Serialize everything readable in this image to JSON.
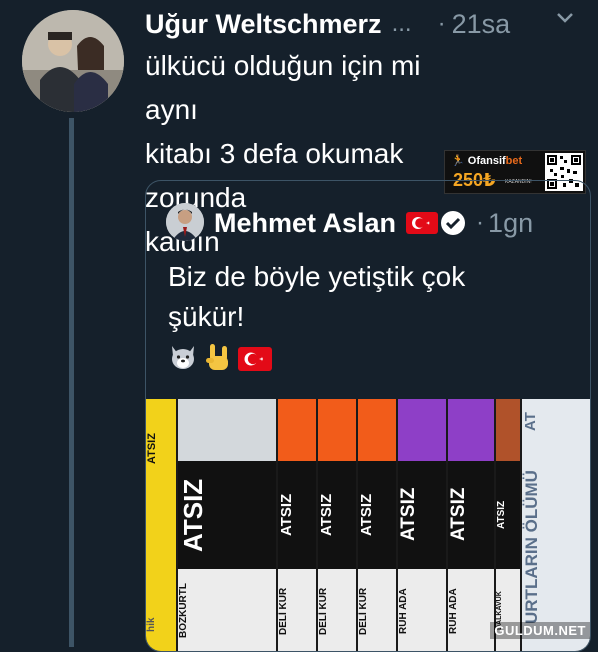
{
  "tweet": {
    "author_name": "Uğur Weltschmerz",
    "ellipsis": "...",
    "separator": "·",
    "time": "21sa",
    "text": "ülkücü olduğun için mi aynı\nkitabı 3 defa okumak zorunda\nkaldın"
  },
  "ad": {
    "brand_a": "Ofansif",
    "brand_b": "bet",
    "amount": "250₺",
    "cta": "KAZANDIN!"
  },
  "quoted_tweet": {
    "author_name": "Mehmet Aslan",
    "separator": "·",
    "time": "1gn",
    "text": "Biz de böyle yetiştik çok\nşükür!",
    "emojis": [
      "wolf-emoji",
      "rock-hand-emoji",
      "turkey-flag-emoji"
    ]
  },
  "photo": {
    "books": [
      {
        "spine": "ATSIZ",
        "subtitle": "hik"
      },
      {
        "spine": "ATSIZ",
        "subtitle": "BOZKURTL"
      },
      {
        "spine": "ATSIZ",
        "subtitle": "DELİ KUR"
      },
      {
        "spine": "ATSIZ",
        "subtitle": "DELİ KUR"
      },
      {
        "spine": "ATSIZ",
        "subtitle": "DELİ KUR"
      },
      {
        "spine": "ATSIZ",
        "subtitle": "RUH ADA"
      },
      {
        "spine": "ATSIZ",
        "subtitle": "RUH ADA"
      },
      {
        "spine": "ATSIZ",
        "subtitle": "DALKAVUK"
      },
      {
        "spine": "AT",
        "subtitle": "URTLARIN ÖLÜMÜ"
      }
    ]
  },
  "watermark": "GULDUM.NET",
  "colors": {
    "background": "#15202b",
    "secondary_text": "#8899a6",
    "border": "#3d5466",
    "turkey_red": "#e30a17",
    "verified_blue": "#1da1f2"
  }
}
